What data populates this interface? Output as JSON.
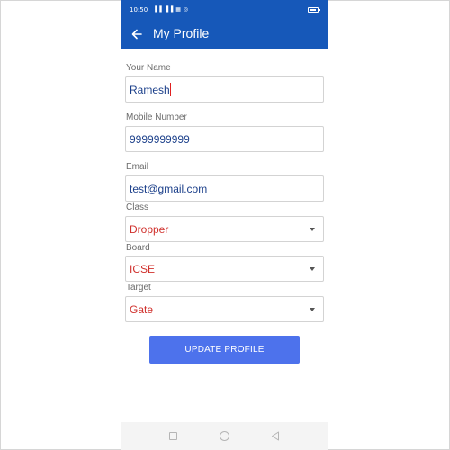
{
  "status_bar": {
    "time": "10:50",
    "icons": "▐▐ ▐▐ ▦ ◎",
    "battery_icon": "battery-icon"
  },
  "app_bar": {
    "title": "My Profile",
    "back_icon": "arrow-left-icon",
    "color": "#1658b9"
  },
  "form": {
    "name": {
      "label": "Your Name",
      "value": "Ramesh"
    },
    "mobile": {
      "label": "Mobile Number",
      "value": "9999999999"
    },
    "email": {
      "label": "Email",
      "value": "test@gmail.com"
    },
    "class": {
      "label": "Class",
      "value": "Dropper"
    },
    "board": {
      "label": "Board",
      "value": "ICSE"
    },
    "target": {
      "label": "Target",
      "value": "Gate"
    }
  },
  "update_button": {
    "label": "UPDATE PROFILE",
    "color": "#4d72ec"
  },
  "nav_bar": {
    "recents_icon": "square-icon",
    "home_icon": "circle-icon",
    "back_icon": "triangle-back-icon"
  }
}
